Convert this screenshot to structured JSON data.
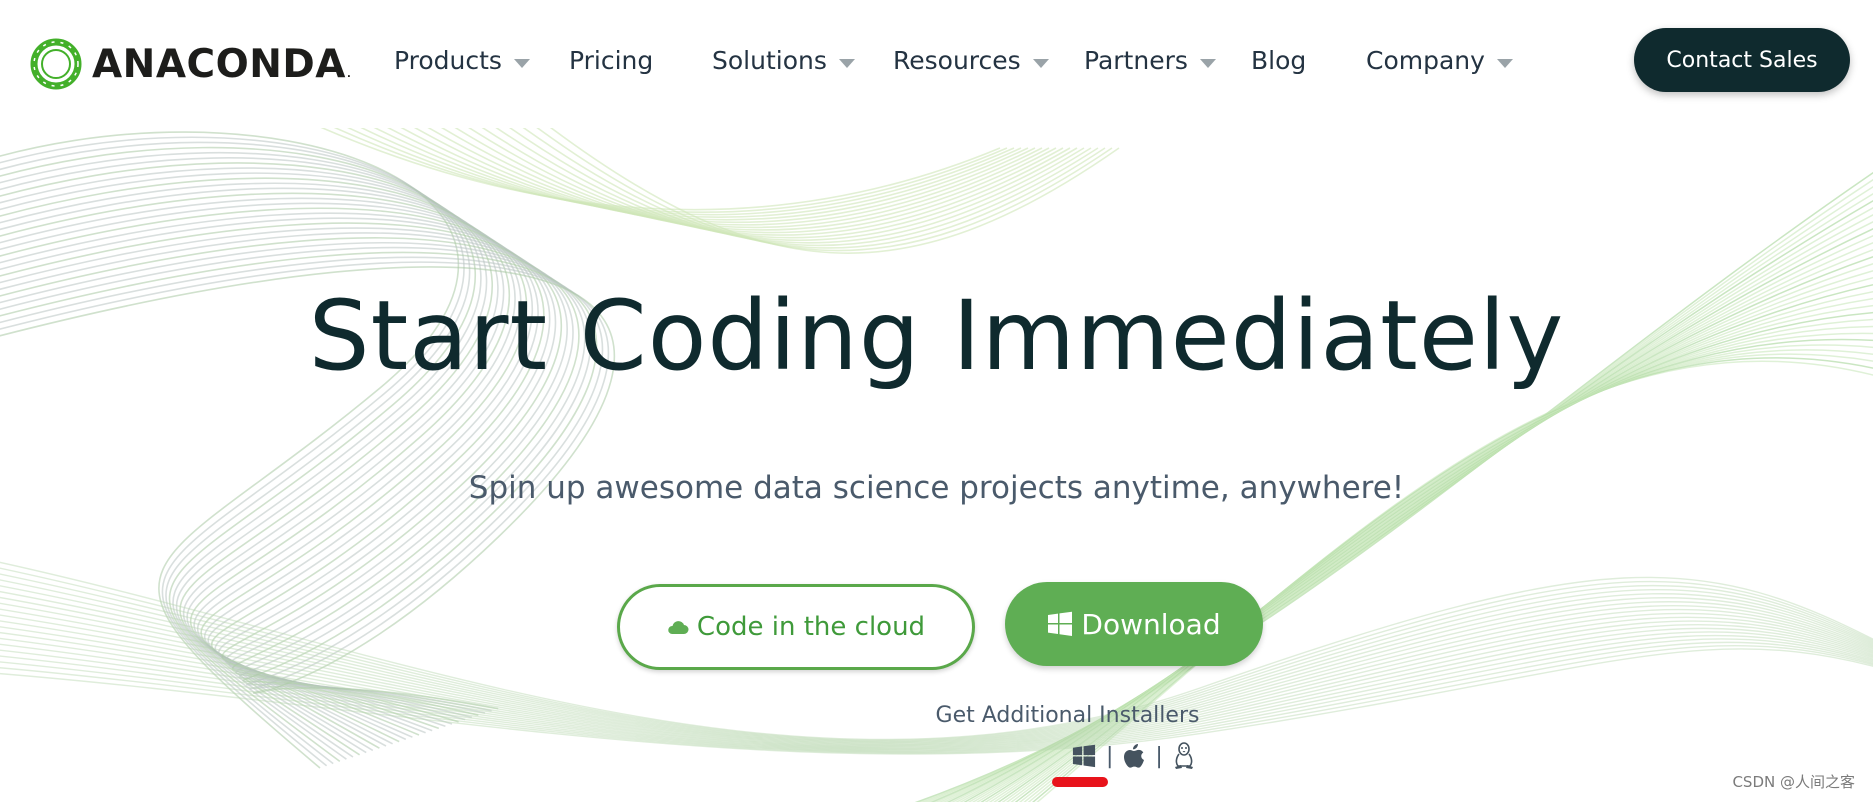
{
  "header": {
    "logo_text": "ANACONDA",
    "logo_mark": ".",
    "nav": [
      {
        "label": "Products",
        "has_dropdown": true
      },
      {
        "label": "Pricing",
        "has_dropdown": false
      },
      {
        "label": "Solutions",
        "has_dropdown": true
      },
      {
        "label": "Resources",
        "has_dropdown": true
      },
      {
        "label": "Partners",
        "has_dropdown": true
      },
      {
        "label": "Blog",
        "has_dropdown": false
      },
      {
        "label": "Company",
        "has_dropdown": true
      }
    ],
    "contact_button": "Contact Sales"
  },
  "hero": {
    "title": "Start Coding Immediately",
    "subtitle": "Spin up awesome data science projects anytime, anywhere!",
    "cloud_button": {
      "label": "Code in the cloud",
      "icon": "cloud-icon"
    },
    "download_button": {
      "label": "Download",
      "icon": "windows-icon"
    },
    "installers_label": "Get Additional Installers",
    "installers": [
      {
        "icon": "windows-icon"
      },
      {
        "icon": "apple-icon"
      },
      {
        "icon": "linux-icon"
      }
    ],
    "separator": "|"
  },
  "watermark": "CSDN @人间之客",
  "colors": {
    "brand_dark": "#0f2a2e",
    "brand_green": "#5fae54",
    "annotation_red": "#e8131b"
  }
}
